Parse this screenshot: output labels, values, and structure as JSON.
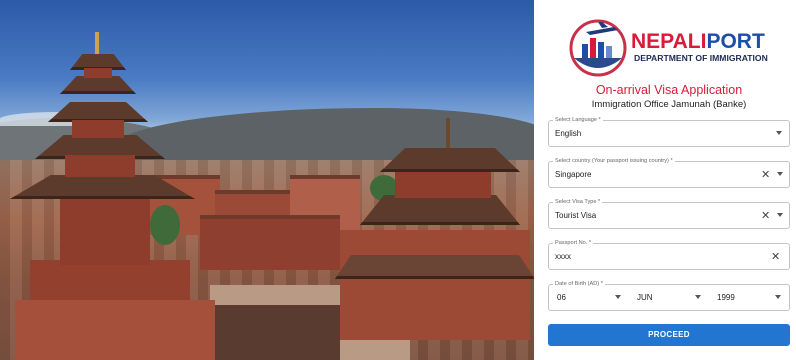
{
  "brand": {
    "name_part1": "NEPALI",
    "name_part2": "PORT",
    "department": "DEPARTMENT OF IMMIGRATION",
    "logo_icon": "airplane-globe-logo-icon"
  },
  "form": {
    "title": "On-arrival Visa Application",
    "subtitle": "Immigration Office Jamunah (Banke)",
    "language": {
      "label": "Select Language *",
      "value": "English"
    },
    "country": {
      "label": "Select country (Your passport issuing country) *",
      "value": "Singapore"
    },
    "visa_type": {
      "label": "Select Visa Type *",
      "value": "Tourist Visa"
    },
    "passport": {
      "label": "Passport No. *",
      "value": "xxxx"
    },
    "dob": {
      "label": "Date of Birth (AD) *",
      "day": "06",
      "month": "JUN",
      "year": "1999"
    },
    "proceed_label": "PROCEED"
  },
  "colors": {
    "accent_red": "#d81b3a",
    "brand_blue": "#1f4ea8",
    "button_blue": "#2276d2"
  },
  "icons": {
    "dropdown": "chevron-down-icon",
    "clear": "close-icon"
  }
}
